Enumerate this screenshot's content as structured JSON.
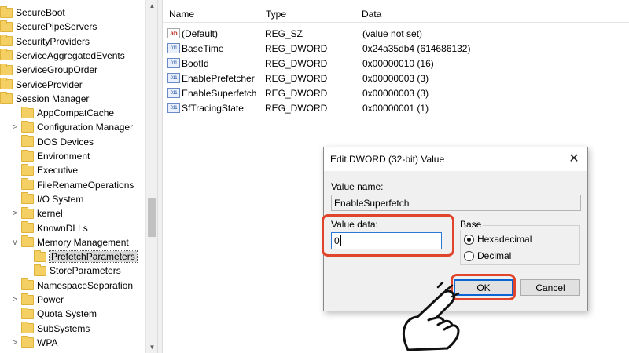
{
  "tree": {
    "items": [
      {
        "label": "SecureBoot",
        "level": 0,
        "expander": ""
      },
      {
        "label": "SecurePipeServers",
        "level": 0,
        "expander": ""
      },
      {
        "label": "SecurityProviders",
        "level": 0,
        "expander": ""
      },
      {
        "label": "ServiceAggregatedEvents",
        "level": 0,
        "expander": ""
      },
      {
        "label": "ServiceGroupOrder",
        "level": 0,
        "expander": ""
      },
      {
        "label": "ServiceProvider",
        "level": 0,
        "expander": ""
      },
      {
        "label": "Session Manager",
        "level": 0,
        "expander": ""
      },
      {
        "label": "AppCompatCache",
        "level": 1,
        "expander": ""
      },
      {
        "label": "Configuration Manager",
        "level": 1,
        "expander": ">"
      },
      {
        "label": "DOS Devices",
        "level": 1,
        "expander": ""
      },
      {
        "label": "Environment",
        "level": 1,
        "expander": ""
      },
      {
        "label": "Executive",
        "level": 1,
        "expander": ""
      },
      {
        "label": "FileRenameOperations",
        "level": 1,
        "expander": ""
      },
      {
        "label": "I/O System",
        "level": 1,
        "expander": ""
      },
      {
        "label": "kernel",
        "level": 1,
        "expander": ">"
      },
      {
        "label": "KnownDLLs",
        "level": 1,
        "expander": ""
      },
      {
        "label": "Memory Management",
        "level": 1,
        "expander": "v"
      },
      {
        "label": "PrefetchParameters",
        "level": 2,
        "expander": "",
        "selected": true
      },
      {
        "label": "StoreParameters",
        "level": 2,
        "expander": ""
      },
      {
        "label": "NamespaceSeparation",
        "level": 1,
        "expander": ""
      },
      {
        "label": "Power",
        "level": 1,
        "expander": ">"
      },
      {
        "label": "Quota System",
        "level": 1,
        "expander": ""
      },
      {
        "label": "SubSystems",
        "level": 1,
        "expander": ""
      },
      {
        "label": "WPA",
        "level": 1,
        "expander": ">"
      }
    ],
    "scroll_up_icon": "▲",
    "scroll_down_icon": "▼"
  },
  "list": {
    "columns": [
      "Name",
      "Type",
      "Data"
    ],
    "rows": [
      {
        "icon": "ab",
        "icon_name": "string-value-icon",
        "name": "(Default)",
        "type": "REG_SZ",
        "data": "(value not set)"
      },
      {
        "icon": "011",
        "icon_name": "dword-value-icon",
        "name": "BaseTime",
        "type": "REG_DWORD",
        "data": "0x24a35db4 (614686132)"
      },
      {
        "icon": "011",
        "icon_name": "dword-value-icon",
        "name": "BootId",
        "type": "REG_DWORD",
        "data": "0x00000010 (16)"
      },
      {
        "icon": "011",
        "icon_name": "dword-value-icon",
        "name": "EnablePrefetcher",
        "type": "REG_DWORD",
        "data": "0x00000003 (3)"
      },
      {
        "icon": "011",
        "icon_name": "dword-value-icon",
        "name": "EnableSuperfetch",
        "type": "REG_DWORD",
        "data": "0x00000003 (3)"
      },
      {
        "icon": "011",
        "icon_name": "dword-value-icon",
        "name": "SfTracingState",
        "type": "REG_DWORD",
        "data": "0x00000001 (1)"
      }
    ]
  },
  "dialog": {
    "title": "Edit DWORD (32-bit) Value",
    "close_glyph": "✕",
    "value_name_label": "Value name:",
    "value_name": "EnableSuperfetch",
    "value_data_label": "Value data:",
    "value_data": "0",
    "base_label": "Base",
    "radio_hex": "Hexadecimal",
    "radio_dec": "Decimal",
    "ok_label": "OK",
    "cancel_label": "Cancel"
  },
  "colors": {
    "highlight": "#e0452b",
    "folder": "#f4cf63",
    "default_button_border": "#0a64d6"
  }
}
